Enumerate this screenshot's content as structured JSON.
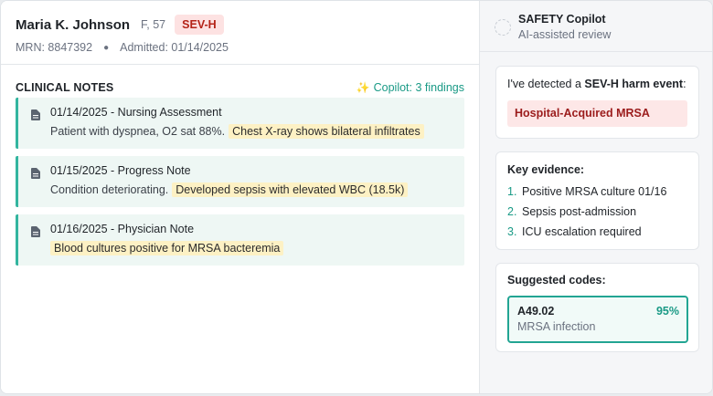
{
  "patient": {
    "name": "Maria K. Johnson",
    "demographics": "F, 57",
    "severity_badge": "SEV-H",
    "mrn": "MRN: 8847392",
    "admitted": "Admitted: 01/14/2025"
  },
  "notes": {
    "title": "CLINICAL NOTES",
    "findings": "Copilot: 3 findings",
    "items": [
      {
        "title": "01/14/2025 - Nursing Assessment",
        "text": "Patient with dyspnea, O2 sat 88%.",
        "highlight": "Chest X-ray shows bilateral infiltrates"
      },
      {
        "title": "01/15/2025 - Progress Note",
        "text": "Condition deteriorating.",
        "highlight": "Developed sepsis with elevated WBC (18.5k)"
      },
      {
        "title": "01/16/2025 - Physician Note",
        "text": "",
        "highlight": "Blood cultures positive for MRSA bacteremia"
      }
    ]
  },
  "copilot": {
    "title": "SAFETY Copilot",
    "subtitle": "AI-assisted review",
    "detected_prefix": "I've detected a",
    "detected_severity": "SEV-H harm event",
    "detected_suffix": ":",
    "harm_event": "Hospital-Acquired MRSA",
    "evidence_title": "Key evidence:",
    "evidence": [
      {
        "num": "1.",
        "text": "Positive MRSA culture 01/16"
      },
      {
        "num": "2.",
        "text": "Sepsis post-admission"
      },
      {
        "num": "3.",
        "text": "ICU escalation required"
      }
    ],
    "codes_title": "Suggested codes:",
    "code": {
      "id": "A49.02",
      "confidence": "95%",
      "description": "MRSA infection"
    }
  },
  "colors": {
    "accent": "#1a9a86",
    "severity": "#b42318",
    "highlight": "#fdf1c4"
  }
}
